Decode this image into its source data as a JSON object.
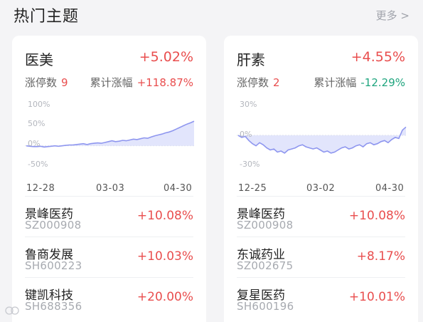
{
  "header": {
    "title": "热门主题",
    "more_label": "更多 >"
  },
  "cards": [
    {
      "name": "医美",
      "change": "+5.02%",
      "limit_up_label": "涨停数",
      "limit_up_count": "9",
      "cumulative_label": "累计涨幅",
      "cumulative_value": "+118.87%",
      "chart_data": {
        "type": "area",
        "y_axis_labels": [
          "100%",
          "50%",
          "0%",
          "-50%"
        ],
        "ylim": [
          -50,
          100
        ],
        "x_tick_labels": [
          "12-28",
          "03-03",
          "04-30"
        ],
        "values": [
          0,
          -1,
          -2,
          -2,
          -1,
          -3,
          -2,
          -1,
          0,
          -1,
          0,
          1,
          2,
          2,
          3,
          4,
          5,
          3,
          5,
          6,
          7,
          6,
          8,
          10,
          12,
          10,
          11,
          13,
          12,
          14,
          16,
          15,
          17,
          19,
          18,
          21,
          24,
          26,
          28,
          31,
          33,
          36,
          40,
          44,
          48,
          52,
          55,
          59
        ]
      },
      "stocks": [
        {
          "name": "景峰医药",
          "code": "SZ000908",
          "change": "+10.08%"
        },
        {
          "name": "鲁商发展",
          "code": "SH600223",
          "change": "+10.03%"
        },
        {
          "name": "键凯科技",
          "code": "SH688356",
          "change": "+20.00%"
        }
      ]
    },
    {
      "name": "肝素",
      "change": "+4.55%",
      "limit_up_label": "涨停数",
      "limit_up_count": "2",
      "cumulative_label": "累计涨幅",
      "cumulative_value": "-12.29%",
      "chart_data": {
        "type": "area",
        "y_axis_labels": [
          "30%",
          "0%",
          "-30%"
        ],
        "ylim": [
          -30,
          30
        ],
        "x_tick_labels": [
          "12-25",
          "03-02",
          "04-30"
        ],
        "values": [
          0,
          -2,
          -1,
          -5,
          -8,
          -10,
          -7,
          -9,
          -12,
          -14,
          -13,
          -16,
          -15,
          -17,
          -14,
          -13,
          -12,
          -10,
          -9,
          -11,
          -12,
          -13,
          -12,
          -14,
          -16,
          -15,
          -17,
          -16,
          -14,
          -12,
          -11,
          -13,
          -12,
          -10,
          -9,
          -11,
          -8,
          -7,
          -9,
          -8,
          -6,
          -5,
          -7,
          -4,
          -2,
          -3,
          5,
          8
        ]
      },
      "stocks": [
        {
          "name": "景峰医药",
          "code": "SZ000908",
          "change": "+10.08%"
        },
        {
          "name": "东诚药业",
          "code": "SZ002675",
          "change": "+8.17%"
        },
        {
          "name": "复星医药",
          "code": "SH600196",
          "change": "+10.01%"
        }
      ]
    }
  ],
  "colors": {
    "up": "#e94e4e",
    "down": "#1fa57e",
    "line": "#8e96ef",
    "fill": "#dde0fb"
  }
}
